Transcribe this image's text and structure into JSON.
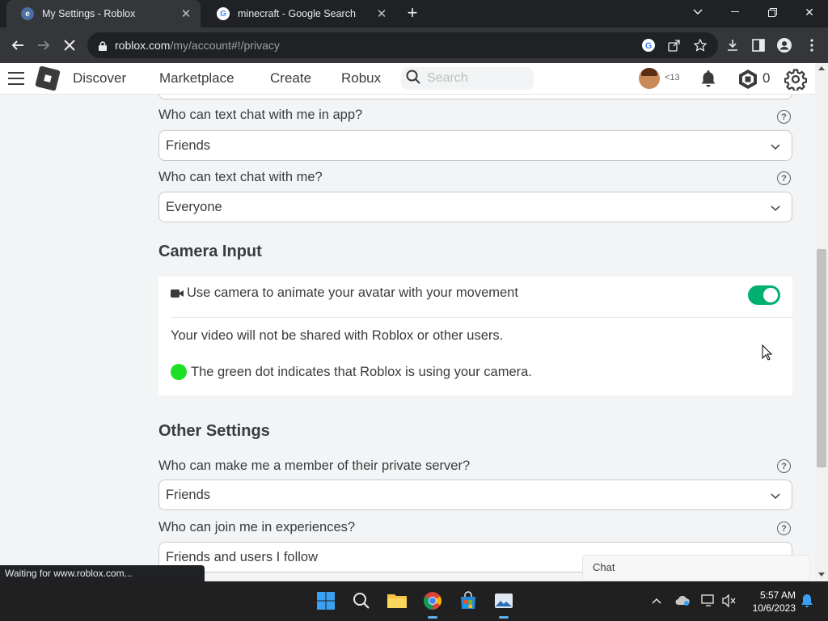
{
  "browser": {
    "tabs": [
      {
        "title": "My Settings - Roblox",
        "active": true
      },
      {
        "title": "minecraft - Google Search",
        "active": false
      }
    ],
    "url_host": "roblox.com",
    "url_path": "/my/account#!/privacy",
    "status_text": "Waiting for www.roblox.com..."
  },
  "header": {
    "nav": [
      "Discover",
      "Marketplace",
      "Create",
      "Robux"
    ],
    "search_placeholder": "Search",
    "age_label": "<13",
    "robux_balance": "0"
  },
  "settings": {
    "chat_app_label": "Who can text chat with me in app?",
    "chat_app_value": "Friends",
    "chat_label": "Who can text chat with me?",
    "chat_value": "Everyone",
    "camera_title": "Camera Input",
    "camera_toggle_label": "Use camera to animate your avatar with your movement",
    "camera_toggle_on": true,
    "camera_note": "Your video will not be shared with Roblox or other users.",
    "camera_dot_note": "The green dot indicates that Roblox is using your camera.",
    "other_title": "Other Settings",
    "private_server_label": "Who can make me a member of their private server?",
    "private_server_value": "Friends",
    "join_label": "Who can join me in experiences?",
    "join_value": "Friends and users I follow"
  },
  "chat": {
    "label": "Chat"
  },
  "taskbar": {
    "time": "5:57 AM",
    "date": "10/6/2023"
  },
  "colors": {
    "toggle_on": "#00b06f",
    "green_dot": "#1de025",
    "chrome_dark": "#202124"
  }
}
